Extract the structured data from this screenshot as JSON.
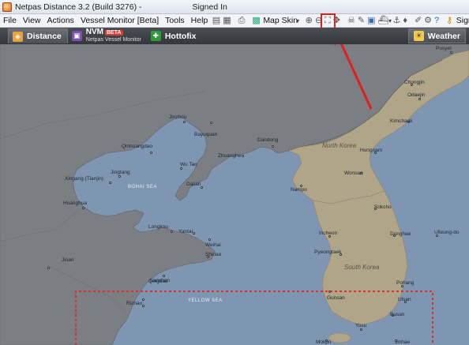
{
  "window": {
    "title": "Netpas Distance 3.2 (Build 3276) -",
    "status": "Signed In"
  },
  "menu": {
    "items": [
      "File",
      "View",
      "Actions",
      "Vessel Monitor [Beta]",
      "Tools",
      "Help"
    ],
    "map_skin": "Map Skin",
    "sign_out": "Sign Out"
  },
  "tabs": [
    {
      "label": "Distance"
    },
    {
      "label": "NVM",
      "badge": "BETA",
      "sub": "Netpas Vessel Monitor"
    },
    {
      "label": "Hottofix"
    }
  ],
  "weather_label": "Weather",
  "map": {
    "countries": [
      "North Korea",
      "South Korea"
    ],
    "seas": [
      "BOHAI SEA",
      "YELLOW SEA"
    ],
    "ports": [
      "Posyet",
      "Chongjin",
      "Odaejin",
      "Kimchaek",
      "Hungnam",
      "Wonsan",
      "Sokcho",
      "Donghae",
      "Ulleung-do",
      "Pohang",
      "Ulsan",
      "Busan",
      "Jinhae",
      "Yosu",
      "Mokpo",
      "Gunsan",
      "Pyeongtaek",
      "Incheon",
      "Nampo",
      "Dandong",
      "Zhuanghe",
      "Dalian",
      "Wu Tao",
      "Bayuquan",
      "Jinzhou",
      "Qinhuangdao",
      "Jingtang",
      "Xingang (Tianjin)",
      "Huanghua",
      "Longkou",
      "Yantai",
      "Weihai",
      "Shidao",
      "Lanshan",
      "Qingdao",
      "Rizhao",
      "Jinan"
    ],
    "colors": {
      "sea": "#7f96b2",
      "land_china": "#7b7e83",
      "land_korea": "#b0a489",
      "highlight": "#e0201a",
      "route_box": "#e0302a"
    }
  }
}
